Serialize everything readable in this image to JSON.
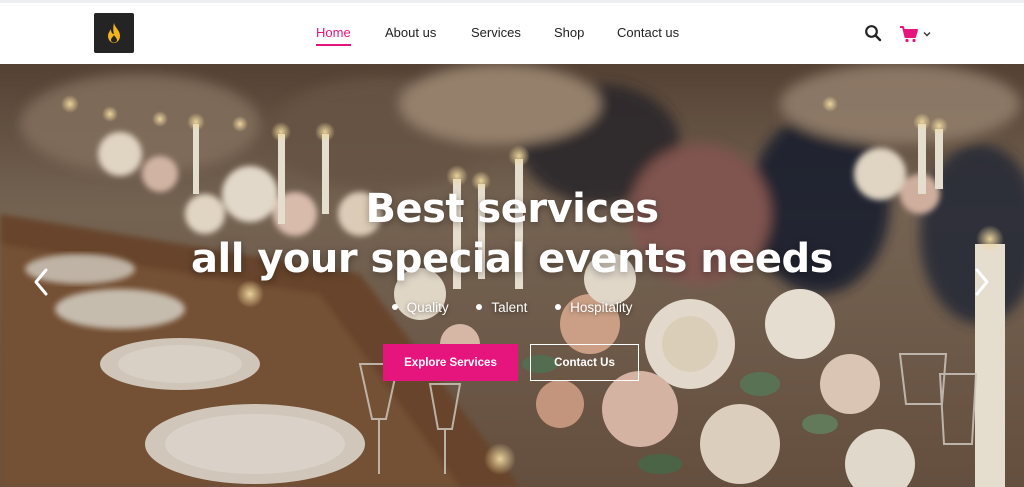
{
  "header": {
    "logo": {
      "icon": "flame-icon"
    },
    "nav": [
      {
        "label": "Home",
        "active": true
      },
      {
        "label": "About us",
        "active": false
      },
      {
        "label": "Services",
        "active": false
      },
      {
        "label": "Shop",
        "active": false
      },
      {
        "label": "Contact us",
        "active": false
      }
    ],
    "icons": {
      "search": "search-icon",
      "cart": "cart-icon",
      "cart_dropdown": "chevron-down-icon"
    }
  },
  "hero": {
    "title_line1": "Best services",
    "title_line2": "all your special events needs",
    "features": [
      "Quality",
      "Talent",
      "Hospitality"
    ],
    "primary_button": "Explore Services",
    "secondary_button": "Contact Us",
    "background_image": "wedding banquet table with candles and flower arrangements"
  },
  "colors": {
    "accent": "#e5157d",
    "nav_text": "#222222",
    "logo_bg": "#242424",
    "hero_text": "#ffffff"
  }
}
